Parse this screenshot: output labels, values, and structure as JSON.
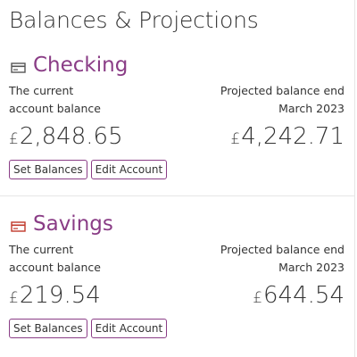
{
  "page": {
    "title": "Balances & Projections"
  },
  "accounts": [
    {
      "name": "Checking",
      "icon": "card-icon",
      "current_label_line1": "The current",
      "current_label_line2": "account balance",
      "projected_label_line1": "Projected balance end",
      "projected_label_line2": "March 2023",
      "currency_symbol": "£",
      "current_balance": "2,848.65",
      "projected_balance": "4,242.71",
      "set_balances_label": "Set Balances",
      "edit_account_label": "Edit Account",
      "icon_color": "#555555"
    },
    {
      "name": "Savings",
      "icon": "card-icon",
      "current_label_line1": "The current",
      "current_label_line2": "account balance",
      "projected_label_line1": "Projected balance end",
      "projected_label_line2": "March 2023",
      "currency_symbol": "£",
      "current_balance": "219.54",
      "projected_balance": "644.54",
      "set_balances_label": "Set Balances",
      "edit_account_label": "Edit Account",
      "icon_color": "#c0392b"
    }
  ],
  "colors": {
    "accent": "#8a3d86",
    "text": "#333333",
    "divider": "#e6e6e6"
  }
}
